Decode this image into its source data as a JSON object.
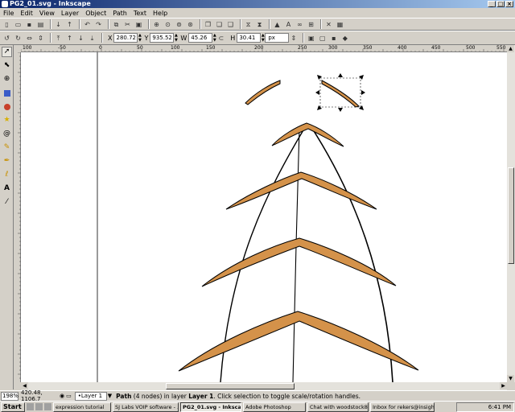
{
  "window": {
    "title": "PG2_01.svg - Inkscape"
  },
  "menu": [
    "File",
    "Edit",
    "View",
    "Layer",
    "Object",
    "Path",
    "Text",
    "Help"
  ],
  "toolbar_main": {
    "icons": [
      "new-icon",
      "open-icon",
      "save-icon",
      "print-icon",
      "import-icon",
      "export-icon",
      "undo-icon",
      "redo-icon",
      "copy-icon",
      "cut-icon",
      "paste-icon",
      "zoom-selection-icon",
      "zoom-drawing-icon",
      "zoom-page-icon",
      "duplicate-icon",
      "clone-icon",
      "unlink-clone-icon",
      "group-icon",
      "ungroup-icon",
      "fill-stroke-icon",
      "text-font-icon",
      "layers-icon",
      "xml-editor-icon",
      "align-icon",
      "preferences-icon",
      "document-properties-icon"
    ]
  },
  "toolbar_select": {
    "x_label": "X",
    "x_value": "280.72",
    "y_label": "Y",
    "y_value": "935.52",
    "w_label": "W",
    "w_value": "45.26",
    "h_label": "H",
    "h_value": "30.41",
    "unit": "px"
  },
  "rulers": {
    "top": [
      "100",
      "-50",
      "0",
      "50",
      "100",
      "150",
      "200",
      "250",
      "300",
      "350",
      "400",
      "450",
      "500",
      "550"
    ],
    "left": [
      "1200",
      "1150",
      "1100",
      "1050",
      "1000",
      "950",
      "900",
      "850"
    ]
  },
  "status": {
    "zoom": "198%",
    "coords": "420.48, 1106.7",
    "layer": "•Layer 1",
    "message_bold": "Path",
    "message": " (4 nodes) in layer ",
    "message_layer": "Layer 1",
    "message_tail": ". Click selection to toggle scale/rotation handles."
  },
  "taskbar": {
    "start": "Start",
    "tasks": [
      "expression tutorial",
      "SJ Labs VOIP software - ...",
      "PG2_01.svg - Inkscape",
      "Adobe Photoshop",
      "Chat with woodstock870...",
      "Inbox for rekers@insight..."
    ],
    "active_task_index": 2,
    "clock": "6:41 PM"
  },
  "colors": {
    "shape_fill": "#d4924a",
    "shape_stroke": "#000000",
    "title_start": "#0a246a",
    "title_end": "#a6caf0"
  }
}
